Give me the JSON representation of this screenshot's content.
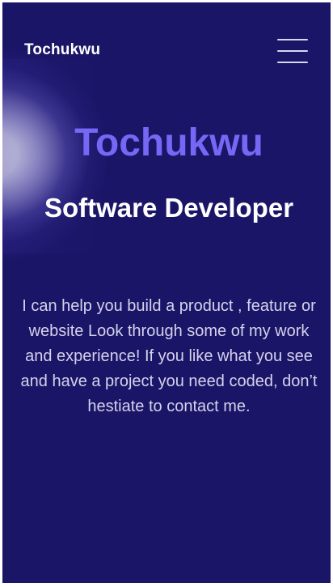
{
  "header": {
    "brand": "Tochukwu",
    "menu_icon": "hamburger-menu-icon"
  },
  "hero": {
    "name": "Tochukwu",
    "role": "Software Developer",
    "intro": "I can help you build a product , feature or website Look through some of my work and experience! If you like what you see and have a project you need coded, don’t hestiate to contact me."
  },
  "colors": {
    "background": "#1b1567",
    "accent": "#7468f5",
    "text": "#ffffff",
    "muted_text": "#d4d2ec"
  }
}
